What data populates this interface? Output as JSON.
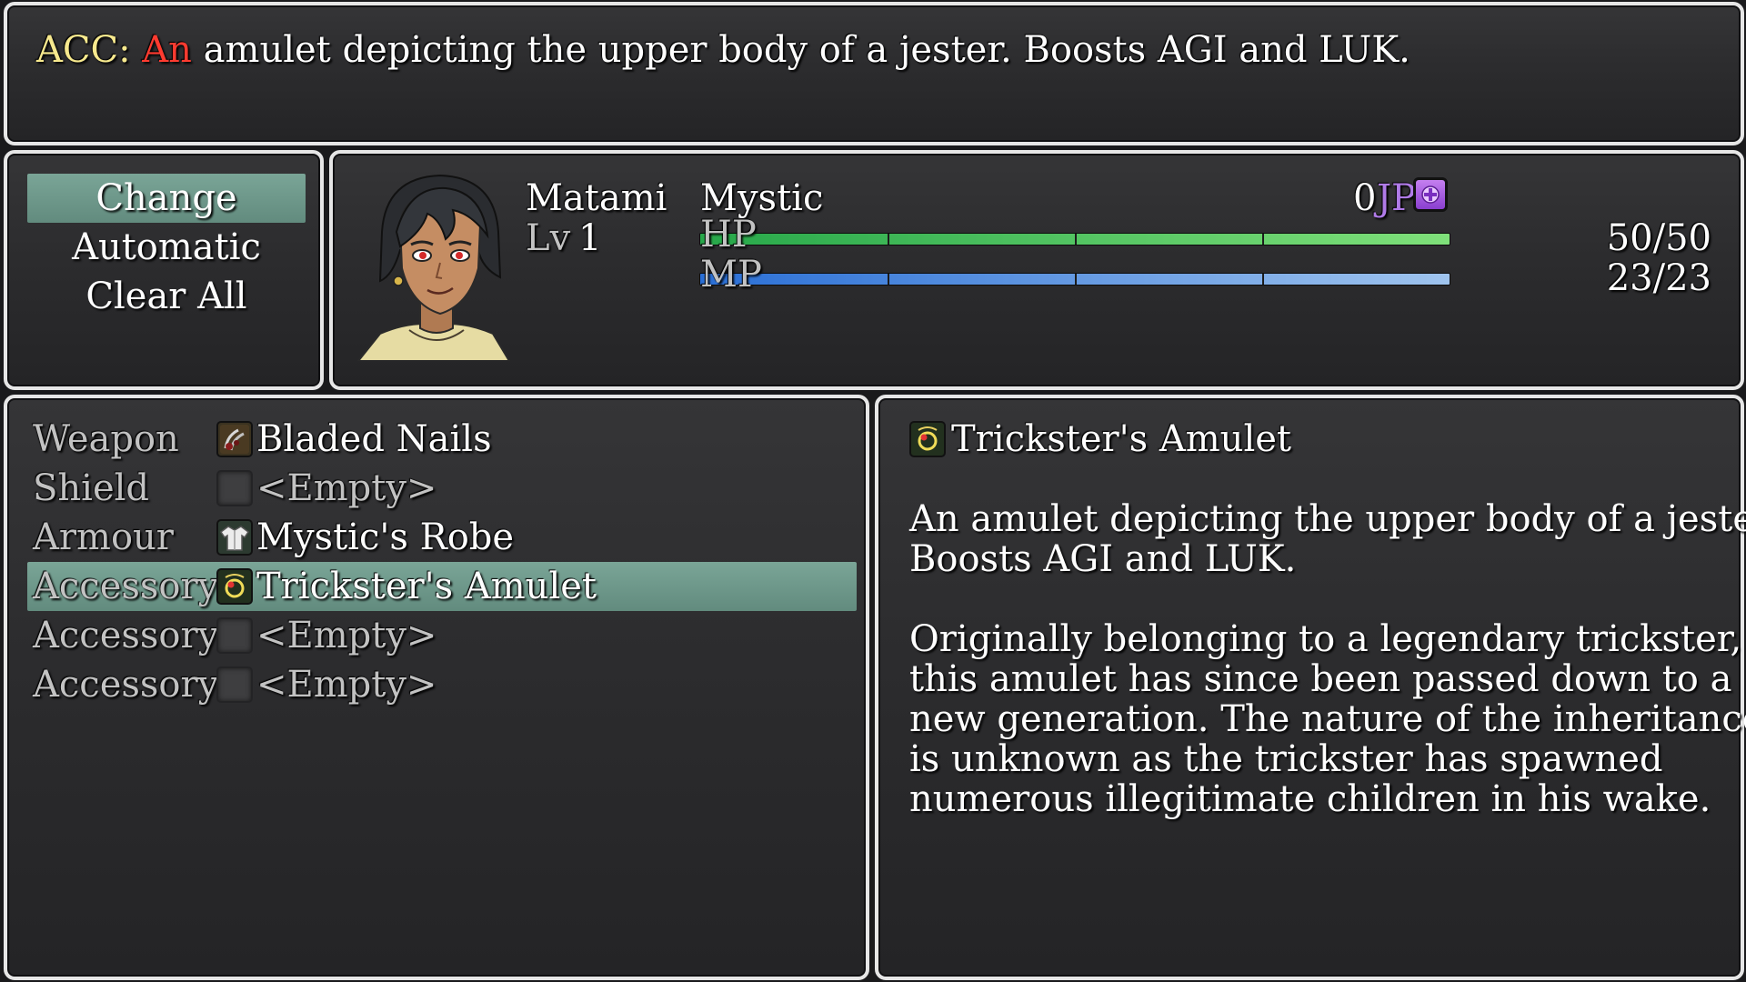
{
  "help": {
    "prefix": "ACC:",
    "highlight": "An",
    "text": "amulet depicting the upper body of a jester. Boosts AGI and LUK.",
    "prefix_color": "#f7e98e",
    "highlight_color": "#ff3b30"
  },
  "commands": [
    {
      "label": "Change",
      "selected": true
    },
    {
      "label": "Automatic",
      "selected": false
    },
    {
      "label": "Clear All",
      "selected": false
    }
  ],
  "actor": {
    "name": "Matami",
    "level_label": "Lv",
    "level": "1",
    "class": "Mystic",
    "jp_value": "0",
    "jp_label": "JP",
    "hp_label": "HP",
    "hp": "50/50",
    "hp_fraction": 1.0,
    "mp_label": "MP",
    "mp": "23/23",
    "mp_fraction": 1.0,
    "portrait_icon": "character-portrait"
  },
  "slots": [
    {
      "type": "Weapon",
      "item": "Bladed Nails",
      "icon": "claw-icon",
      "selected": false
    },
    {
      "type": "Shield",
      "item": "<Empty>",
      "icon": "empty-slot-icon",
      "selected": false
    },
    {
      "type": "Armour",
      "item": "Mystic's Robe",
      "icon": "robe-icon",
      "selected": false
    },
    {
      "type": "Accessory",
      "item": "Trickster's Amulet",
      "icon": "amulet-icon",
      "selected": true
    },
    {
      "type": "Accessory",
      "item": "<Empty>",
      "icon": "empty-slot-icon",
      "selected": false
    },
    {
      "type": "Accessory",
      "item": "<Empty>",
      "icon": "empty-slot-icon",
      "selected": false
    }
  ],
  "info": {
    "item_name": "Trickster's Amulet",
    "icon": "amulet-icon",
    "description_lines": [
      "An amulet depicting the upper body of a jester.",
      "Boosts AGI and LUK.",
      "",
      "Originally belonging to a legendary trickster,",
      "this amulet has since been passed down to a",
      "new generation. The nature of the inheritance",
      "is unknown as the trickster has spawned",
      "numerous illegitimate children in his wake."
    ]
  },
  "colors": {
    "selection": "#6f998b",
    "hp_start": "#27a84a",
    "hp_end": "#7fe07a",
    "mp_start": "#2a6fd6",
    "mp_end": "#9fc4ee",
    "jp_color": "#b07be8",
    "system_text": "#c2c2c2"
  }
}
